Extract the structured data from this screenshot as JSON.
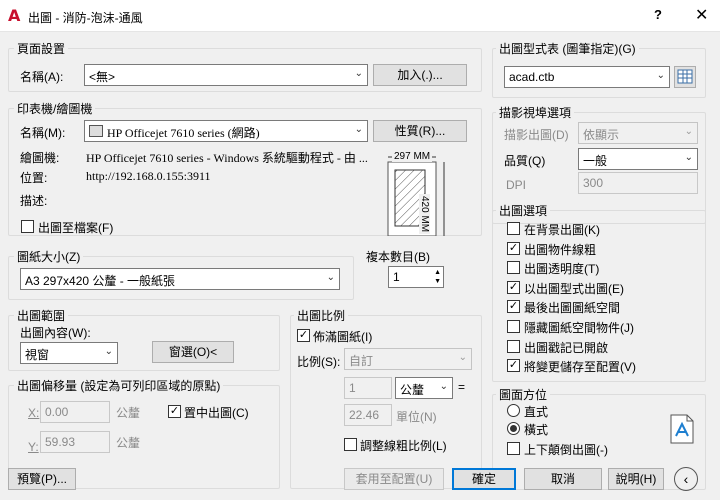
{
  "title": "出圖 - 消防-泡沫-通風",
  "title_help": "?",
  "page_setup": {
    "group": "頁面設置",
    "name_label": "名稱(A):",
    "name_value": "<無>",
    "add_button": "加入(.)..."
  },
  "printer": {
    "group": "印表機/繪圖機",
    "name_label": "名稱(M):",
    "name_value": "HP Officejet 7610 series (網路)",
    "properties_button": "性質(R)...",
    "plotter_label": "繪圖機:",
    "plotter_value": "HP Officejet 7610 series - Windows 系統驅動程式 - 由 ...",
    "where_label": "位置:",
    "where_value": "http://192.168.0.155:3911",
    "desc_label": "描述:",
    "plot_to_file": "出圖至檔案(F)",
    "preview_width": "297 MM",
    "preview_height": "420 MM"
  },
  "paper_size": {
    "group": "圖紙大小(Z)",
    "value": "A3 297x420 公釐 - 一般紙張"
  },
  "copies": {
    "label": "複本數目(B)",
    "value": "1"
  },
  "plot_area": {
    "group": "出圖範圍",
    "what_label": "出圖內容(W):",
    "what_value": "視窗",
    "window_button": "窗選(O)<"
  },
  "plot_offset": {
    "group": "出圖偏移量 (設定為可列印區域的原點)",
    "x_label": "X:",
    "x_value": "0.00",
    "y_label": "Y:",
    "y_value": "59.93",
    "unit": "公釐",
    "center": "置中出圖(C)"
  },
  "plot_scale": {
    "group": "出圖比例",
    "fit": "佈滿圖紙(I)",
    "scale_label": "比例(S):",
    "scale_value": "自訂",
    "num_value": "1",
    "unit_value": "公釐",
    "equals": "=",
    "units_value": "22.46",
    "units_label": "單位(N)",
    "lineweights": "調整線粗比例(L)"
  },
  "style_table": {
    "group": "出圖型式表 (圖筆指定)(G)",
    "value": "acad.ctb"
  },
  "shaded": {
    "group": "描影視埠選項",
    "shade_label": "描影出圖(D)",
    "shade_value": "依顯示",
    "quality_label": "品質(Q)",
    "quality_value": "一般",
    "dpi_label": "DPI",
    "dpi_value": "300"
  },
  "plot_options": {
    "group": "出圖選項",
    "items": [
      {
        "label": "在背景出圖(K)",
        "checked": false
      },
      {
        "label": "出圖物件線粗",
        "checked": true
      },
      {
        "label": "出圖透明度(T)",
        "checked": false
      },
      {
        "label": "以出圖型式出圖(E)",
        "checked": true
      },
      {
        "label": "最後出圖圖紙空間",
        "checked": true
      },
      {
        "label": "隱藏圖紙空間物件(J)",
        "checked": false
      },
      {
        "label": "出圖戳記已開啟",
        "checked": false
      },
      {
        "label": "將變更儲存至配置(V)",
        "checked": true
      }
    ]
  },
  "orientation": {
    "group": "圖面方位",
    "portrait": "直式",
    "landscape": "橫式",
    "upside_down": "上下顛倒出圖(-)",
    "selected": "landscape"
  },
  "footer": {
    "preview": "預覽(P)...",
    "apply": "套用至配置(U)",
    "ok": "確定",
    "cancel": "取消",
    "help": "說明(H)"
  }
}
